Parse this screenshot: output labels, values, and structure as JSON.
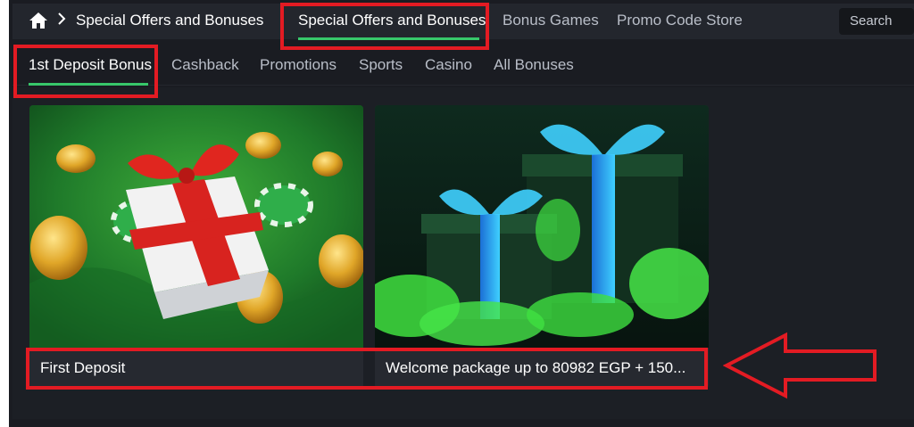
{
  "breadcrumb": {
    "home_icon": "home-icon",
    "chevron_icon": "chevron-right-icon",
    "current": "Special Offers and Bonuses"
  },
  "top_tabs": [
    {
      "label": "Special Offers and Bonuses",
      "active": true
    },
    {
      "label": "Bonus Games",
      "active": false
    },
    {
      "label": "Promo Code Store",
      "active": false
    }
  ],
  "search": {
    "label": "Search"
  },
  "sub_tabs": [
    {
      "label": "1st Deposit Bonus",
      "active": true
    },
    {
      "label": "Cashback",
      "active": false
    },
    {
      "label": "Promotions",
      "active": false
    },
    {
      "label": "Sports",
      "active": false
    },
    {
      "label": "Casino",
      "active": false
    },
    {
      "label": "All Bonuses",
      "active": false
    }
  ],
  "cards": [
    {
      "title": "First Deposit"
    },
    {
      "title": "Welcome package up to 80982 EGP + 150..."
    }
  ],
  "colors": {
    "accent": "#37c76a",
    "annotation_red": "#e31b23",
    "background": "#1a1c22",
    "topbar": "#23262d"
  }
}
